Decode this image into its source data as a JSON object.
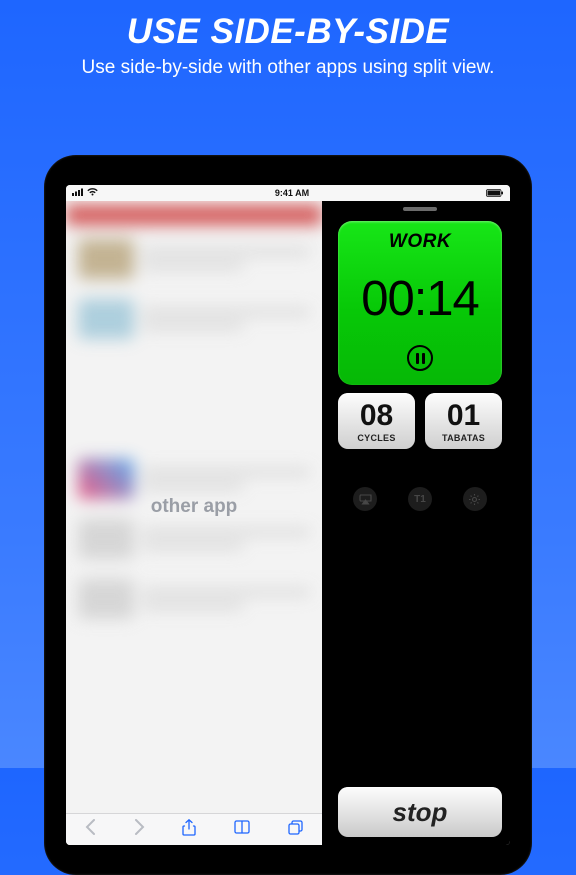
{
  "promo": {
    "title": "USE SIDE-BY-SIDE",
    "subtitle": "Use side-by-side with other apps using split view."
  },
  "status": {
    "time": "9:41 AM"
  },
  "left": {
    "placeholder_label": "other app"
  },
  "timer": {
    "state_label": "WORK",
    "time": "00:14",
    "cycles": {
      "value": "08",
      "label": "CYCLES"
    },
    "tabatas": {
      "value": "01",
      "label": "TABATAS"
    },
    "mini_t_label": "T1",
    "stop_label": "stop"
  },
  "colors": {
    "work_panel": "#0cd20c"
  }
}
